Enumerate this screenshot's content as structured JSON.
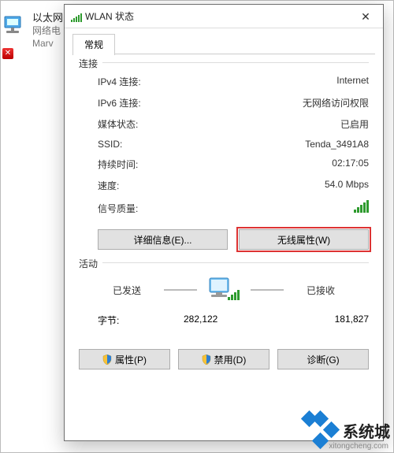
{
  "bg": {
    "title": "以太网",
    "line2": "网络电",
    "line3": "Marv"
  },
  "dialog": {
    "title": "WLAN 状态"
  },
  "tab": {
    "general": "常规"
  },
  "section": {
    "connection": "连接",
    "activity": "活动"
  },
  "conn": {
    "ipv4_label": "IPv4 连接:",
    "ipv4_val": "Internet",
    "ipv6_label": "IPv6 连接:",
    "ipv6_val": "无网络访问权限",
    "media_label": "媒体状态:",
    "media_val": "已启用",
    "ssid_label": "SSID:",
    "ssid_val": "Tenda_3491A8",
    "dur_label": "持续时间:",
    "dur_val": "02:17:05",
    "speed_label": "速度:",
    "speed_val": "54.0 Mbps",
    "signal_label": "信号质量:"
  },
  "btns": {
    "details": "详细信息(E)...",
    "wifiprops": "无线属性(W)"
  },
  "activity": {
    "sent": "已发送",
    "recv": "已接收",
    "bytes_label": "字节:",
    "sent_bytes": "282,122",
    "recv_bytes": "181,827"
  },
  "bottom": {
    "props": "属性(P)",
    "disable": "禁用(D)",
    "diag": "诊断(G)"
  },
  "wm": {
    "text": "系统城",
    "url": "xitongcheng.com"
  }
}
